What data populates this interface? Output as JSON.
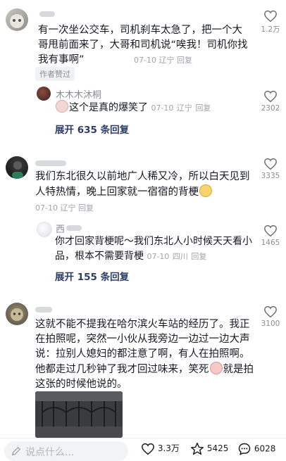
{
  "comments": [
    {
      "text": "有一次坐公交车，司机刹车太急了，把一个大哥甩前面来了，大哥和司机说“唉我！司机你找我有事啊”",
      "date": "07-10",
      "location": "辽宁",
      "reply_label": "回复",
      "badge": "作者赞过",
      "likes": "1.2万",
      "reply": {
        "user": "木木木沐桐",
        "text": "这个是真的爆笑了",
        "date": "07-10",
        "location": "辽宁",
        "reply_label": "回复",
        "likes": "2302"
      },
      "expand": "展开 635 条回复"
    },
    {
      "text": "我们东北很久以前地广人稀又冷，所以白天见到人特热情，晚上回家就一宿宿的背梗",
      "date": "07-10",
      "location": "辽宁",
      "reply_label": "回复",
      "likes": "3335",
      "reply": {
        "user": "西",
        "text": "你才回家背梗呢～我们东北人小时候天天看小品，根本不需要背梗",
        "date": "07-10",
        "location": "四川",
        "reply_label": "回复",
        "likes": "1465"
      },
      "expand": "展开 155 条回复"
    },
    {
      "text_a": "这就不能不提我在哈尔滨火车站的经历了。我正在拍照呢，突然一小伙从我旁边一边过一边大声说：拉别人媳妇的都注意了啊，有人在拍照啊。他都走过几秒钟了我才回过味来，笑死",
      "text_b": "就是拍这张的时候他说的。",
      "likes": "3100"
    }
  ],
  "bottom_bar": {
    "input_placeholder": "说点什么...",
    "likes": "3.3万",
    "favorites": "5425",
    "comments": "6028"
  },
  "icons": {
    "like": "heart-outline-icon",
    "favorite": "star-outline-icon",
    "comment": "chat-bubble-icon",
    "edit": "pencil-icon"
  }
}
